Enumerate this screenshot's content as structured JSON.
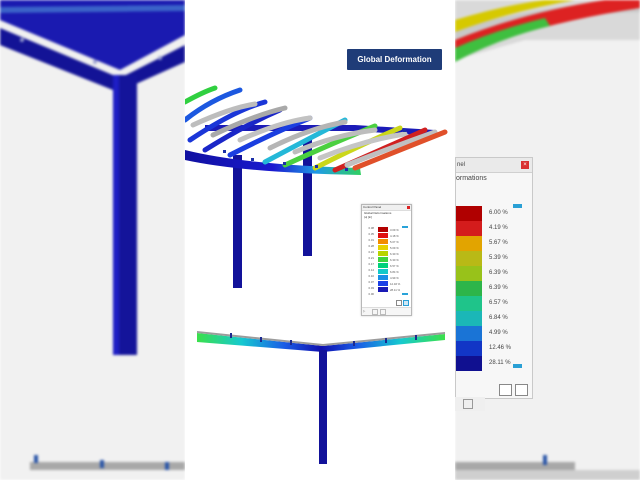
{
  "title_badge": "Global Deformation",
  "control_panel": {
    "title": "Control Panel",
    "subtitle_line1": "Global Deformations",
    "subtitle_line2": "|u| [in]",
    "legend_values": [
      "0.38",
      "0.35",
      "0.31",
      "0.28",
      "0.24",
      "0.21",
      "0.17",
      "0.14",
      "0.10",
      "0.07",
      "0.03",
      "0.00"
    ],
    "legend_percents": [
      "3.09 %",
      "4.18 %",
      "5.07 %",
      "5.09 %",
      "6.30 %",
      "6.30 %",
      "6.57 %",
      "6.84 %",
      "4.99 %",
      "12.46 %",
      "28.11 %"
    ],
    "legend_colors": [
      "#b30000",
      "#e01010",
      "#f28c00",
      "#e6d200",
      "#b8d400",
      "#3fd43f",
      "#00d27a",
      "#13c9c9",
      "#1a8fe6",
      "#1a3fe6",
      "#1a1ab5"
    ]
  },
  "right_panel": {
    "title_fragment": "nel",
    "subtitle_fragment": "ormations",
    "percents": [
      "6.00 %",
      "4.19 %",
      "5.67 %",
      "5.39 %",
      "6.39 %",
      "6.39 %",
      "6.57 %",
      "6.84 %",
      "4.99 %",
      "12.46 %",
      "28.11 %"
    ],
    "colors": [
      "#b00000",
      "#d41c1c",
      "#e2a400",
      "#b9b916",
      "#98c21a",
      "#2db54a",
      "#1fc48a",
      "#1bb7b7",
      "#1a74d6",
      "#1236c6",
      "#101090"
    ]
  }
}
